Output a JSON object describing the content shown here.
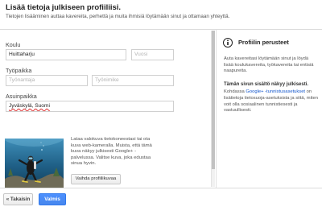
{
  "header": {
    "title": "Lisää tietoja julkiseen profiiliisi.",
    "subtitle": "Tietojen lisääminen auttaa kavereita, perhettä ja muita ihmisiä löytämään sinut ja ottamaan yhteyttä."
  },
  "form": {
    "school": {
      "label": "Koulu",
      "value": "Huittaharju",
      "year_placeholder": "Vuosi"
    },
    "work": {
      "label": "Työpaikka",
      "employer_placeholder": "Työnantaja",
      "title_placeholder": "Työnimike"
    },
    "residence": {
      "label": "Asuinpaikka",
      "value": "Jyväskylä, Suomi"
    }
  },
  "photo": {
    "description": "Lataa valokuva tietokoneestasi tai ota kuva web-kameralla. Muista, että tämä kuva näkyy julkisesti Google+ -palvelussa. Valitse kuva, joka edustaa sinua hyvin.",
    "change_button": "Vaihda profiilikuvaa"
  },
  "info_panel": {
    "title": "Profiilin perusteet",
    "p1": "Auta kavereitasi löytämään sinut ja löydä lisää koulukavereita, työkavereita tai entisiä naapureita.",
    "p2_title": "Tämän sivun sisältö näkyy julkisesti.",
    "p2_before": "Kohdassa ",
    "p2_link": "Google+ -tunnistusasetukset",
    "p2_after": " on lisätietoja tietosuoja-asetuksista ja siitä, miten voit olla sosiaalinen tunnistiesesti ja vastuullisesti."
  },
  "footer": {
    "back_label": "« Takaisin",
    "done_label": "Valmis"
  },
  "colors": {
    "accent_blue": "#4d90fe",
    "link": "#1155cc",
    "underwater": "#1f5f86"
  },
  "icons": {
    "info": "info-icon"
  }
}
